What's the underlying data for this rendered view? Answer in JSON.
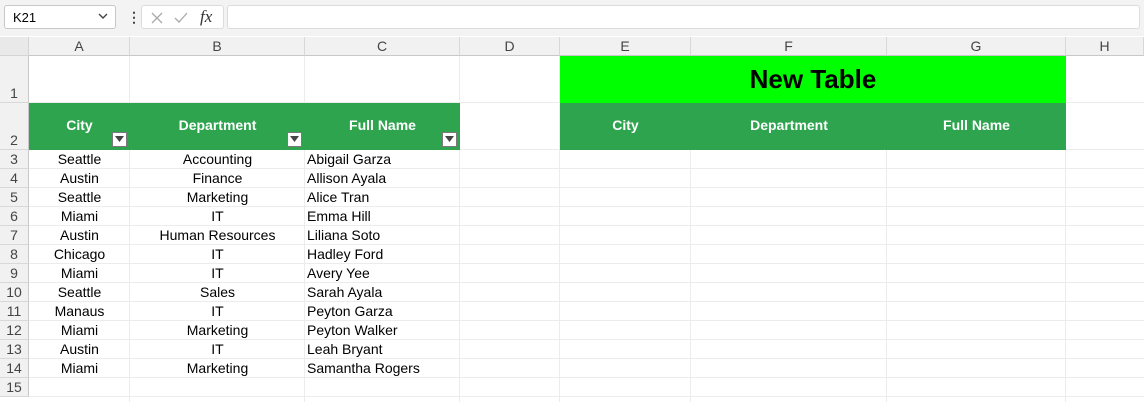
{
  "formula_bar": {
    "name_box": "K21",
    "fx_label": "fx",
    "formula_value": ""
  },
  "columns": [
    "A",
    "B",
    "C",
    "D",
    "E",
    "F",
    "G",
    "H"
  ],
  "rows": [
    "1",
    "2",
    "3",
    "4",
    "5",
    "6",
    "7",
    "8",
    "9",
    "10",
    "11",
    "12",
    "13",
    "14",
    "15"
  ],
  "source_table": {
    "headers": [
      "City",
      "Department",
      "Full Name"
    ],
    "rows": [
      [
        "Seattle",
        "Accounting",
        "Abigail Garza"
      ],
      [
        "Austin",
        "Finance",
        "Allison Ayala"
      ],
      [
        "Seattle",
        "Marketing",
        "Alice Tran"
      ],
      [
        "Miami",
        "IT",
        "Emma Hill"
      ],
      [
        "Austin",
        "Human Resources",
        "Liliana Soto"
      ],
      [
        "Chicago",
        "IT",
        "Hadley Ford"
      ],
      [
        "Miami",
        "IT",
        "Avery Yee"
      ],
      [
        "Seattle",
        "Sales",
        "Sarah Ayala"
      ],
      [
        "Manaus",
        "IT",
        "Peyton Garza"
      ],
      [
        "Miami",
        "Marketing",
        "Peyton Walker"
      ],
      [
        "Austin",
        "IT",
        "Leah Bryant"
      ],
      [
        "Miami",
        "Marketing",
        "Samantha Rogers"
      ]
    ]
  },
  "new_table": {
    "title": "New Table",
    "headers": [
      "City",
      "Department",
      "Full Name"
    ]
  },
  "colors": {
    "header_green": "#2ea44f",
    "title_green": "#00ff00"
  }
}
